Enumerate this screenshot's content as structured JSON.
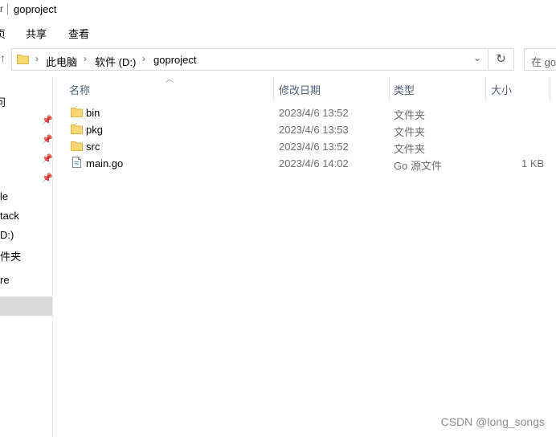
{
  "title": {
    "left_glyph": "r",
    "path": "goproject"
  },
  "ribbon": {
    "file_fragment": "页",
    "share": "共享",
    "view": "查看"
  },
  "address": {
    "up_glyph": "↑",
    "crumbs": [
      "此电脑",
      "软件 (D:)",
      "goproject"
    ],
    "search_placeholder": "在 goproject"
  },
  "nav": {
    "items": [
      {
        "label": "问"
      },
      {
        "label": "le"
      },
      {
        "label": "tack"
      },
      {
        "label": "D:)"
      },
      {
        "label": "件夹"
      },
      {
        "label": "re"
      }
    ]
  },
  "columns": {
    "name": "名称",
    "modified": "修改日期",
    "type": "类型",
    "size": "大小"
  },
  "files": [
    {
      "name": "bin",
      "modified": "2023/4/6 13:52",
      "type": "文件夹",
      "size": "",
      "kind": "folder"
    },
    {
      "name": "pkg",
      "modified": "2023/4/6 13:53",
      "type": "文件夹",
      "size": "",
      "kind": "folder"
    },
    {
      "name": "src",
      "modified": "2023/4/6 13:52",
      "type": "文件夹",
      "size": "",
      "kind": "folder"
    },
    {
      "name": "main.go",
      "modified": "2023/4/6 14:02",
      "type": "Go 源文件",
      "size": "1 KB",
      "kind": "file"
    }
  ],
  "watermark": "CSDN @long_songs",
  "colors": {
    "folder": "#f8d775",
    "folder_edge": "#e0b243",
    "selection": "#d9d9d9",
    "column_header": "#4c607a"
  }
}
